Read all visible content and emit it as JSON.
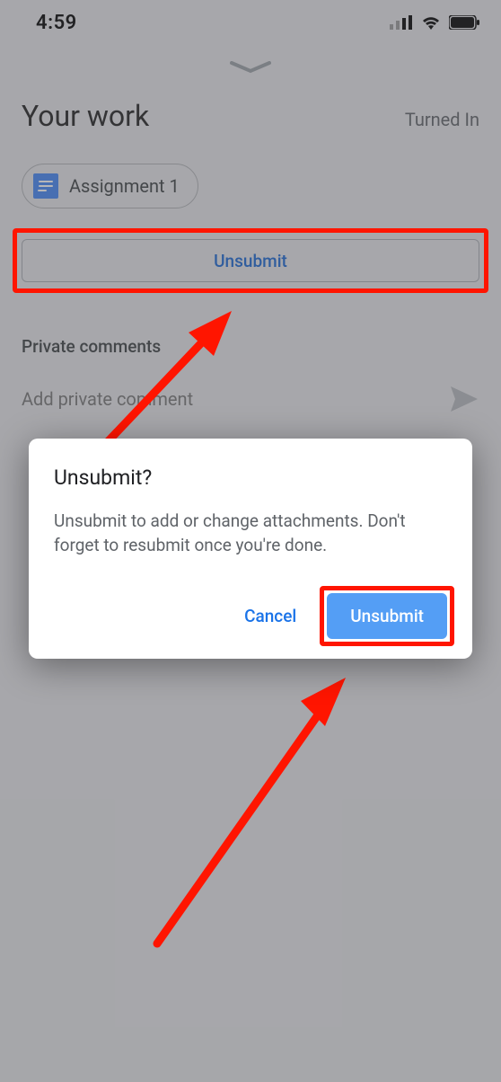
{
  "status_bar": {
    "time": "4:59"
  },
  "header": {
    "title": "Your work",
    "status": "Turned In"
  },
  "attachment": {
    "label": "Assignment 1",
    "icon": "docs-icon"
  },
  "buttons": {
    "unsubmit": "Unsubmit"
  },
  "comments": {
    "section_title": "Private comments",
    "placeholder": "Add private comment"
  },
  "dialog": {
    "title": "Unsubmit?",
    "body": "Unsubmit to add or change attachments. Don't forget to resubmit once you're done.",
    "cancel": "Cancel",
    "confirm": "Unsubmit"
  }
}
